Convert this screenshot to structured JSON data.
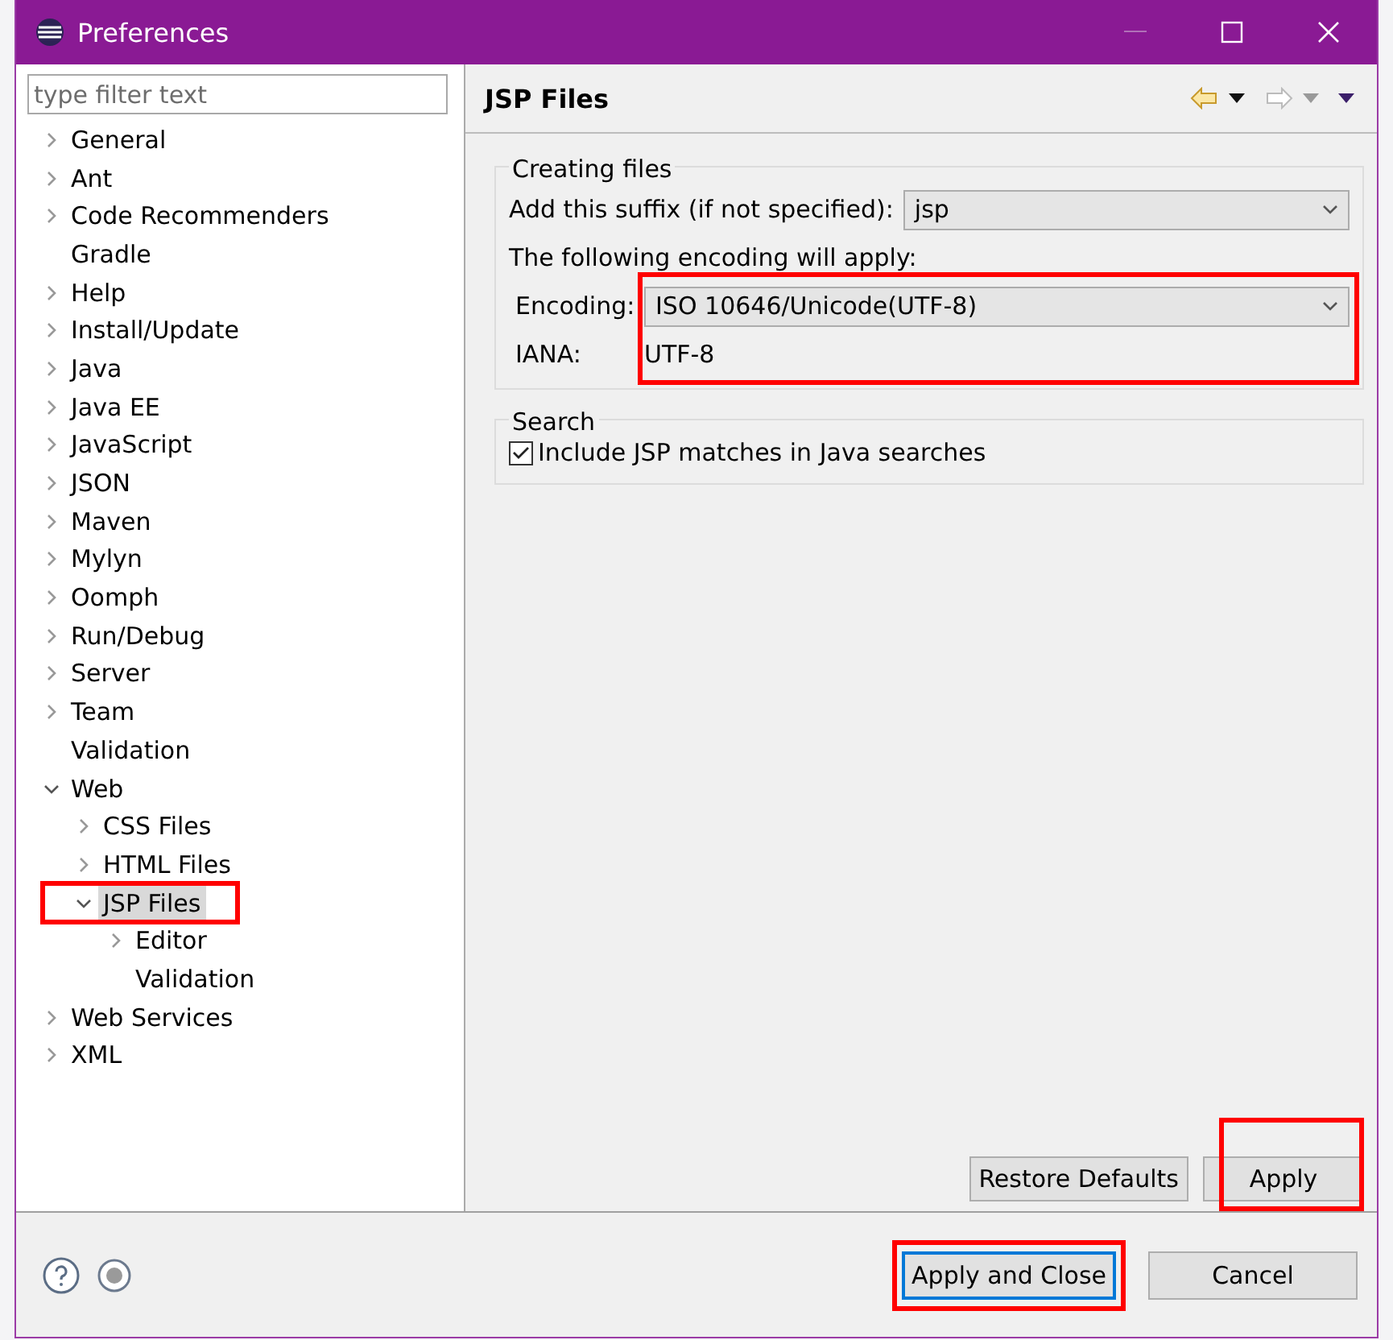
{
  "window": {
    "title": "Preferences"
  },
  "filter": {
    "placeholder": "type filter text"
  },
  "tree": [
    {
      "label": "General",
      "expandable": true,
      "expanded": false,
      "selected": false
    },
    {
      "label": "Ant",
      "expandable": true,
      "expanded": false,
      "selected": false
    },
    {
      "label": "Code Recommenders",
      "expandable": true,
      "expanded": false,
      "selected": false
    },
    {
      "label": "Gradle",
      "expandable": false,
      "selected": false
    },
    {
      "label": "Help",
      "expandable": true,
      "expanded": false,
      "selected": false
    },
    {
      "label": "Install/Update",
      "expandable": true,
      "expanded": false,
      "selected": false
    },
    {
      "label": "Java",
      "expandable": true,
      "expanded": false,
      "selected": false
    },
    {
      "label": "Java EE",
      "expandable": true,
      "expanded": false,
      "selected": false
    },
    {
      "label": "JavaScript",
      "expandable": true,
      "expanded": false,
      "selected": false
    },
    {
      "label": "JSON",
      "expandable": true,
      "expanded": false,
      "selected": false
    },
    {
      "label": "Maven",
      "expandable": true,
      "expanded": false,
      "selected": false
    },
    {
      "label": "Mylyn",
      "expandable": true,
      "expanded": false,
      "selected": false
    },
    {
      "label": "Oomph",
      "expandable": true,
      "expanded": false,
      "selected": false
    },
    {
      "label": "Run/Debug",
      "expandable": true,
      "expanded": false,
      "selected": false
    },
    {
      "label": "Server",
      "expandable": true,
      "expanded": false,
      "selected": false
    },
    {
      "label": "Team",
      "expandable": true,
      "expanded": false,
      "selected": false
    },
    {
      "label": "Validation",
      "expandable": false,
      "selected": false
    },
    {
      "label": "Web",
      "expandable": true,
      "expanded": true,
      "selected": false,
      "children": [
        {
          "label": "CSS Files",
          "expandable": true,
          "expanded": false,
          "selected": false
        },
        {
          "label": "HTML Files",
          "expandable": true,
          "expanded": false,
          "selected": false
        },
        {
          "label": "JSP Files",
          "expandable": true,
          "expanded": true,
          "selected": true,
          "highlighted": true,
          "children": [
            {
              "label": "Editor",
              "expandable": true,
              "expanded": false,
              "selected": false
            },
            {
              "label": "Validation",
              "expandable": false,
              "selected": false
            }
          ]
        }
      ]
    },
    {
      "label": "Web Services",
      "expandable": true,
      "expanded": false,
      "selected": false
    },
    {
      "label": "XML",
      "expandable": true,
      "expanded": false,
      "selected": false
    }
  ],
  "page": {
    "title": "JSP Files",
    "creating_files": {
      "legend": "Creating files",
      "suffix_label": "Add this suffix (if not specified):",
      "suffix_value": "jsp",
      "encoding_note": "The following encoding will apply:",
      "encoding_label": "Encoding:",
      "encoding_value": "ISO 10646/Unicode(UTF-8)",
      "iana_label": "IANA:",
      "iana_value": "UTF-8",
      "highlighted": true
    },
    "search": {
      "legend": "Search",
      "checkbox_label": "Include JSP matches in Java searches",
      "checked": true
    },
    "buttons": [
      {
        "label": "Restore Defaults",
        "highlighted": false
      },
      {
        "label": "Apply",
        "highlighted": true
      }
    ]
  },
  "footer_buttons": [
    {
      "label": "Apply and Close",
      "default": true,
      "highlighted": true
    },
    {
      "label": "Cancel",
      "default": false,
      "highlighted": false
    }
  ]
}
